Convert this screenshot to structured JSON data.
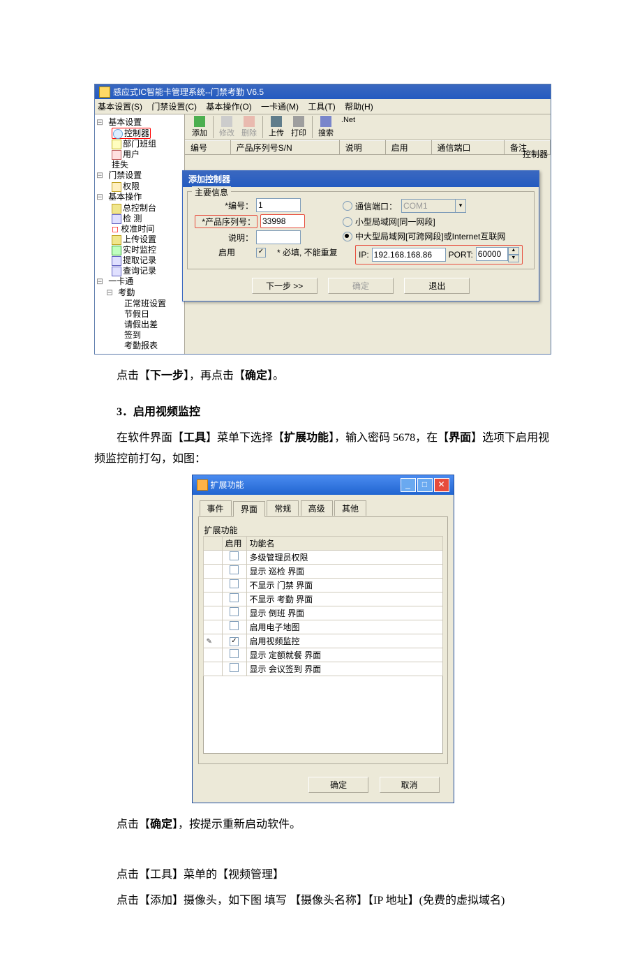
{
  "win1": {
    "title": "感应式IC智能卡管理系统--门禁考勤 V6.5",
    "menus": [
      "基本设置(S)",
      "门禁设置(C)",
      "基本操作(O)",
      "一卡通(M)",
      "工具(T)",
      "帮助(H)"
    ],
    "tree": {
      "basic_settings": "基本设置",
      "controller": "控制器",
      "dept_group": "部门班组",
      "user": "用户",
      "lost": "挂失",
      "access_settings": "门禁设置",
      "perm": "权限",
      "basic_ops": "基本操作",
      "console": "总控制台",
      "check": "检 测",
      "calibrate": "校准时间",
      "upload": "上传设置",
      "realtime": "实时监控",
      "extract": "提取记录",
      "query": "查询记录",
      "onecard": "一卡通",
      "attendance": "考勤",
      "shift": "正常班设置",
      "holiday": "节假日",
      "leave": "请假出差",
      "signin": "签到",
      "report": "考勤报表"
    },
    "toolbar": {
      "add": "添加",
      "edit": "修改",
      "del": "删除",
      "upload": "上传",
      "print": "打印",
      "search": "搜索",
      "net": ".Net"
    },
    "rightLabel": "控制器",
    "listCols": [
      "编号",
      "产品序列号S/N",
      "说明",
      "启用",
      "通信端口",
      "备注"
    ],
    "dialog": {
      "title": "添加控制器",
      "group": "主要信息",
      "lbl_no": "*编号：",
      "val_no": "1",
      "lbl_sn": "*产品序列号：",
      "val_sn": "33998",
      "lbl_desc": "说明：",
      "lbl_enable": "启用",
      "required_note": "* 必填, 不能重复",
      "opt_com": "通信端口：",
      "opt_com_val": "COM1",
      "opt_lan": "小型局域网[同一网段]",
      "opt_wan": "中大型局域网[可跨网段]或Internet互联网",
      "ip_lbl": "IP:",
      "ip_val": "192.168.168.86",
      "port_lbl": "PORT:",
      "port_val": "60000",
      "btn_next": "下一步 >>",
      "btn_ok": "确定",
      "btn_exit": "退出"
    }
  },
  "para1": "点击【下一步】，再点击【确定】。",
  "h3": "3．启用视频监控",
  "para2": "在软件界面【工具】菜单下选择【扩展功能】，输入密码 5678，在【界面】选项下启用视频监控前打勾，如图：",
  "win2": {
    "title": "扩展功能",
    "tabs": [
      "事件",
      "界面",
      "常规",
      "高级",
      "其他"
    ],
    "activeTab": 1,
    "groupLabel": "扩展功能",
    "col_enable": "启用",
    "col_name": "功能名",
    "rows": [
      {
        "on": false,
        "name": "多级管理员权限"
      },
      {
        "on": false,
        "name": "显示 巡检 界面"
      },
      {
        "on": false,
        "name": "不显示 门禁 界面"
      },
      {
        "on": false,
        "name": "不显示 考勤 界面"
      },
      {
        "on": false,
        "name": "显示 倒班 界面"
      },
      {
        "on": false,
        "name": "启用电子地图"
      },
      {
        "on": true,
        "name": "启用视频监控",
        "editing": true
      },
      {
        "on": false,
        "name": "显示 定额就餐 界面"
      },
      {
        "on": false,
        "name": "显示 会议签到 界面"
      }
    ],
    "btn_ok": "确定",
    "btn_cancel": "取消"
  },
  "para3": "点击【确定】，按提示重新启动软件。",
  "para4": "点击【工具】菜单的【视频管理】",
  "para5": "点击【添加】摄像头，如下图 填写 【摄像头名称】【IP 地址】(免费的虚拟域名)"
}
